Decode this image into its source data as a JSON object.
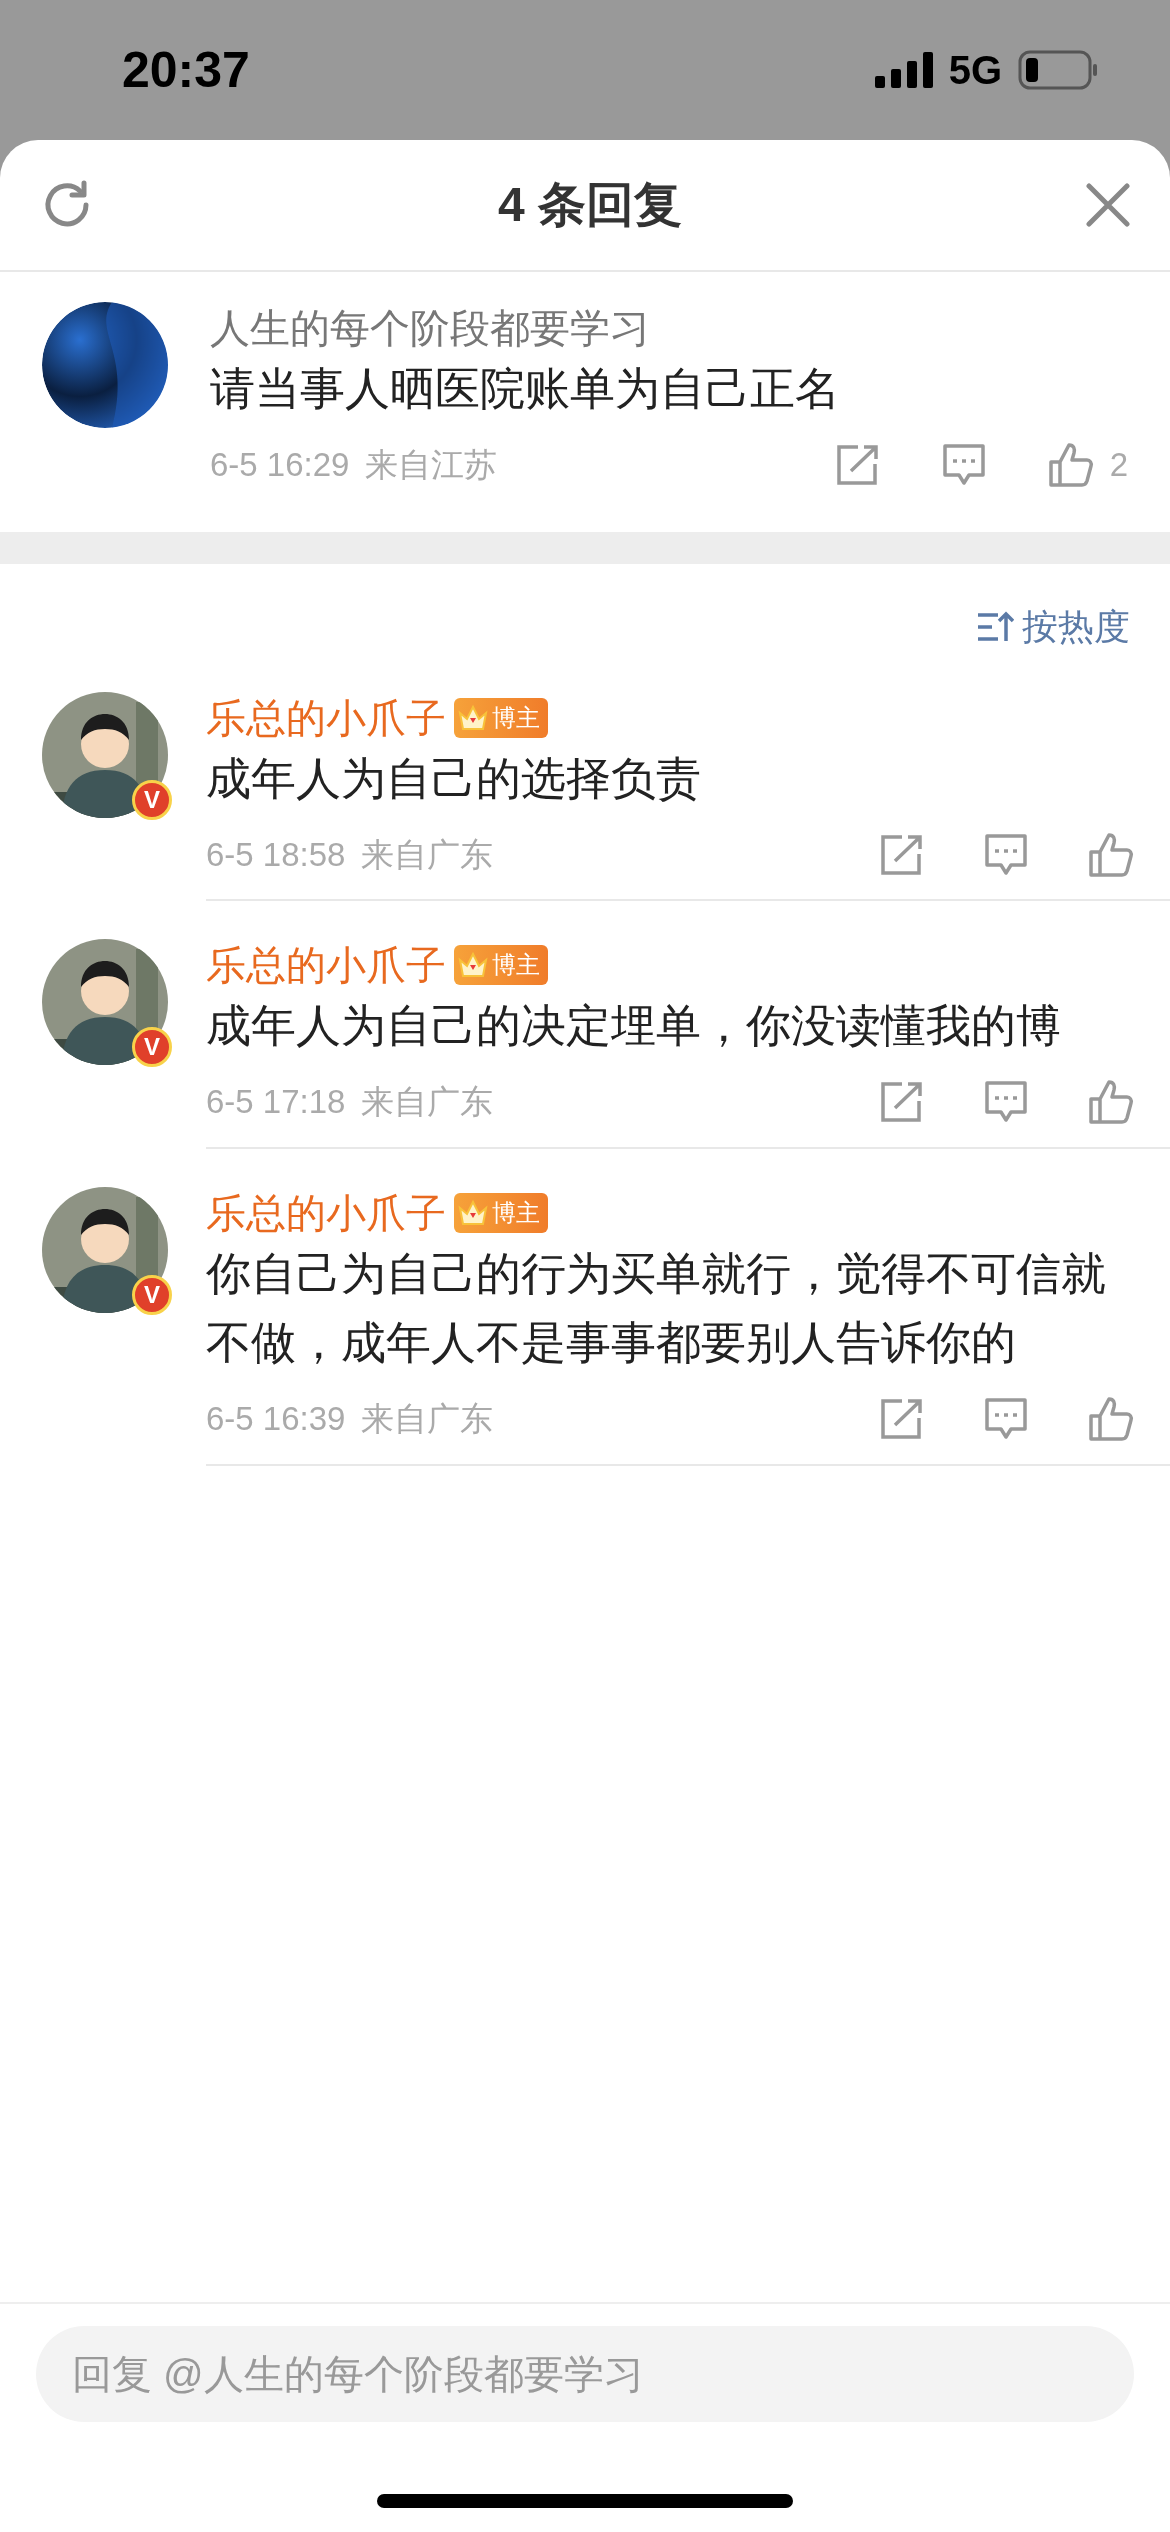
{
  "status_bar": {
    "time": "20:37",
    "network": "5G"
  },
  "header": {
    "title": "4 条回复"
  },
  "root_comment": {
    "author": "人生的每个阶段都要学习",
    "text": "请当事人晒医院账单为自己正名",
    "time": "6-5 16:29",
    "location": "来自江苏",
    "likes": "2"
  },
  "sort": {
    "label": "按热度"
  },
  "replies": [
    {
      "author": "乐总的小爪子",
      "badge": "博主",
      "verified_badge": "V",
      "text": "成年人为自己的选择负责",
      "time": "6-5 18:58",
      "location": "来自广东"
    },
    {
      "author": "乐总的小爪子",
      "badge": "博主",
      "verified_badge": "V",
      "text": "成年人为自己的决定埋单，你没读懂我的博",
      "time": "6-5 17:18",
      "location": "来自广东"
    },
    {
      "author": "乐总的小爪子",
      "badge": "博主",
      "verified_badge": "V",
      "text": "你自己为自己的行为买单就行，觉得不可信就不做，成年人不是事事都要别人告诉你的",
      "time": "6-5 16:39",
      "location": "来自广东"
    }
  ],
  "reply_box": {
    "placeholder": "回复 @人生的每个阶段都要学习"
  }
}
